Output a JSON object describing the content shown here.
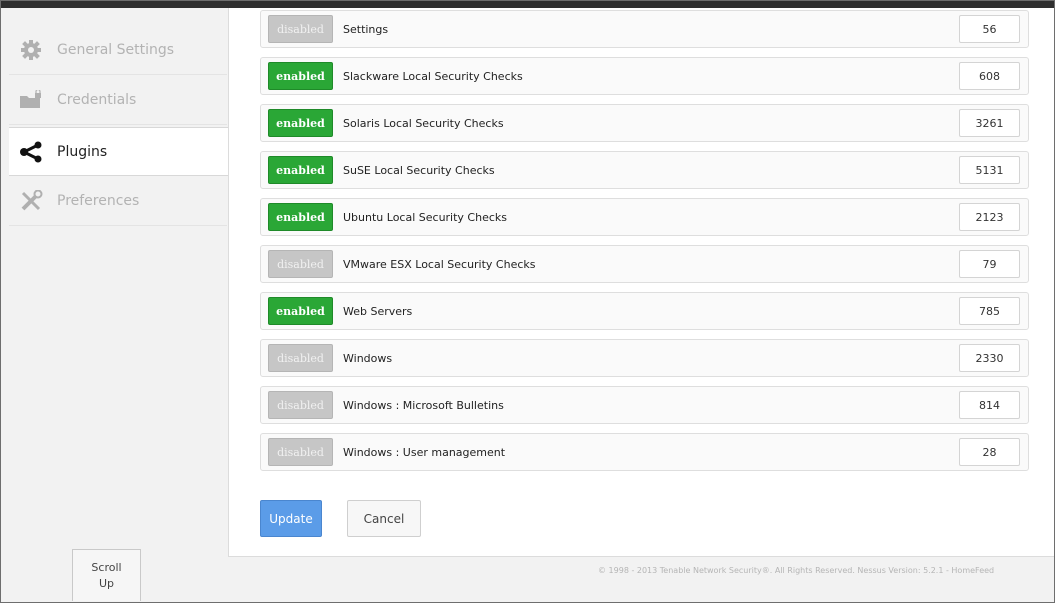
{
  "sidebar": {
    "items": [
      {
        "label": "General Settings",
        "icon": "gear-icon",
        "active": false
      },
      {
        "label": "Credentials",
        "icon": "folder-lock-icon",
        "active": false
      },
      {
        "label": "Plugins",
        "icon": "share-icon",
        "active": true
      },
      {
        "label": "Preferences",
        "icon": "tools-icon",
        "active": false
      }
    ]
  },
  "plugins": {
    "rows": [
      {
        "status": "disabled",
        "name": "Settings",
        "count": "56"
      },
      {
        "status": "enabled",
        "name": "Slackware Local Security Checks",
        "count": "608"
      },
      {
        "status": "enabled",
        "name": "Solaris Local Security Checks",
        "count": "3261"
      },
      {
        "status": "enabled",
        "name": "SuSE Local Security Checks",
        "count": "5131"
      },
      {
        "status": "enabled",
        "name": "Ubuntu Local Security Checks",
        "count": "2123"
      },
      {
        "status": "disabled",
        "name": "VMware ESX Local Security Checks",
        "count": "79"
      },
      {
        "status": "enabled",
        "name": "Web Servers",
        "count": "785"
      },
      {
        "status": "disabled",
        "name": "Windows",
        "count": "2330"
      },
      {
        "status": "disabled",
        "name": "Windows : Microsoft Bulletins",
        "count": "814"
      },
      {
        "status": "disabled",
        "name": "Windows : User management",
        "count": "28"
      }
    ]
  },
  "actions": {
    "update_label": "Update",
    "cancel_label": "Cancel"
  },
  "footer": {
    "text": "© 1998 - 2013 Tenable Network Security®. All Rights Reserved. Nessus Version: 5.2.1 - HomeFeed"
  },
  "scroll_up": {
    "line1": "Scroll",
    "line2": "Up"
  },
  "colors": {
    "enabled": "#2aa736",
    "disabled": "#c6c6c6",
    "update_button": "#5b9ce8"
  }
}
